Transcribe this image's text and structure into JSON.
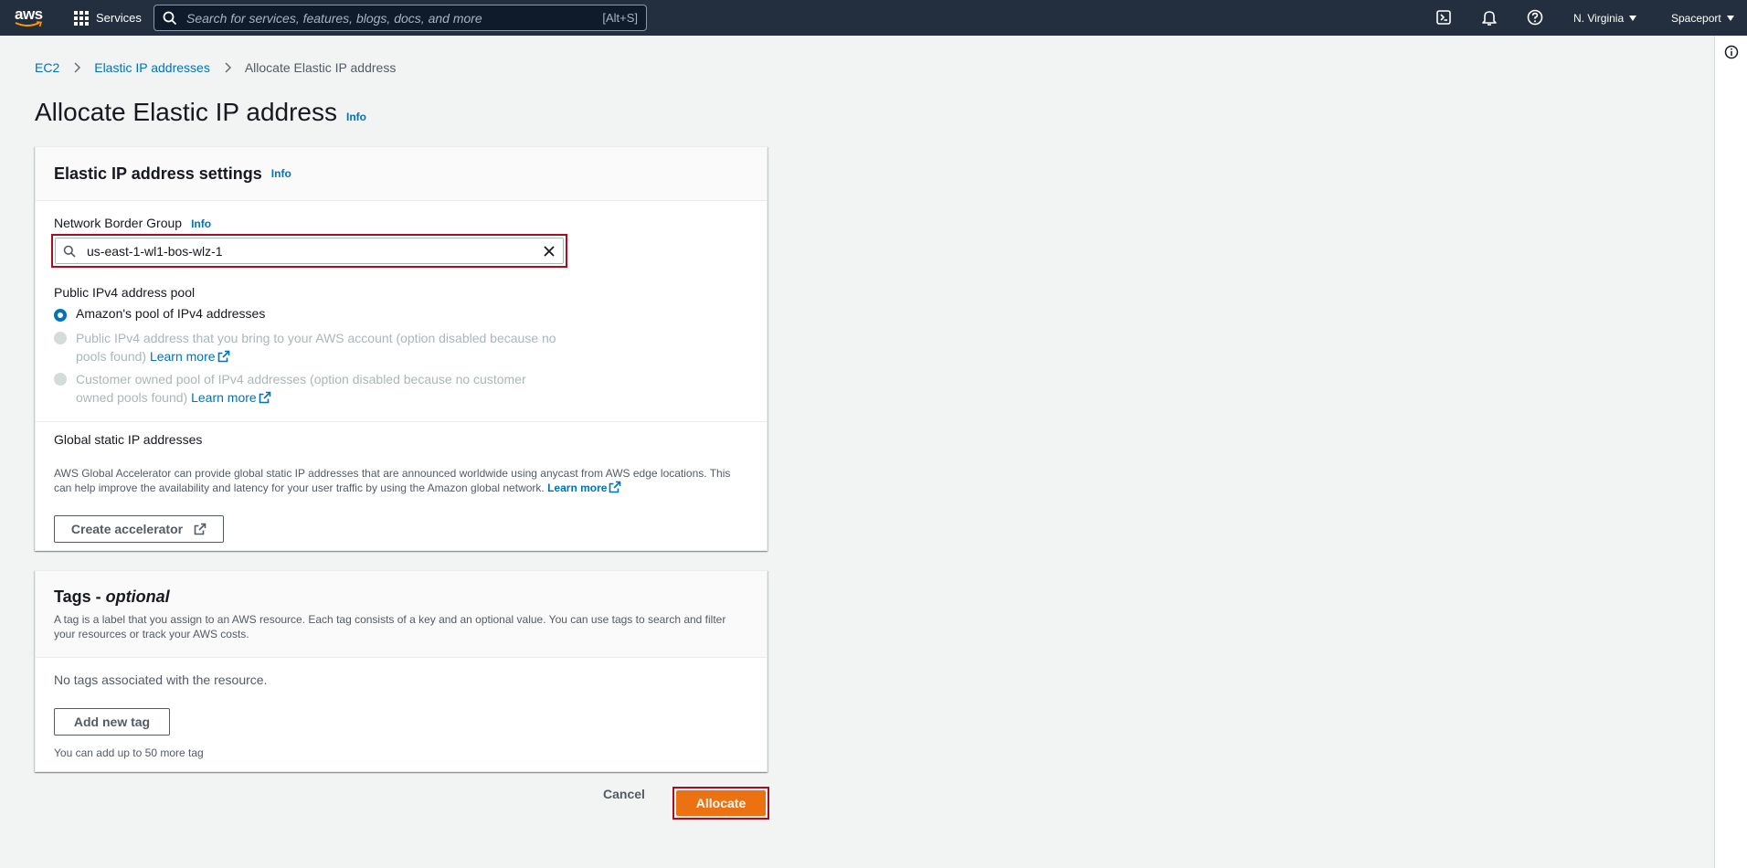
{
  "topnav": {
    "logo_text": "aws",
    "services_label": "Services",
    "search_placeholder": "Search for services, features, blogs, docs, and more",
    "search_shortcut": "[Alt+S]",
    "region": "N. Virginia",
    "account": "Spaceport"
  },
  "breadcrumb": {
    "items": [
      "EC2",
      "Elastic IP addresses"
    ],
    "current": "Allocate Elastic IP address"
  },
  "page": {
    "title": "Allocate Elastic IP address",
    "info": "Info"
  },
  "settings": {
    "header": "Elastic IP address settings",
    "header_info": "Info",
    "nbg_label": "Network Border Group",
    "nbg_info": "Info",
    "nbg_value": "us-east-1-wl1-bos-wlz-1",
    "pool_label": "Public IPv4 address pool",
    "options": [
      {
        "text": "Amazon's pool of IPv4 addresses",
        "selected": true,
        "disabled": false
      },
      {
        "text": "Public IPv4 address that you bring to your AWS account (option disabled because no pools found)",
        "link": "Learn more",
        "selected": false,
        "disabled": true
      },
      {
        "text": "Customer owned pool of IPv4 addresses (option disabled because no customer owned pools found)",
        "link": "Learn more",
        "selected": false,
        "disabled": true
      }
    ],
    "global_label": "Global static IP addresses",
    "global_desc": "AWS Global Accelerator can provide global static IP addresses that are announced worldwide using anycast from AWS edge locations. This can help improve the availability and latency for your user traffic by using the Amazon global network.",
    "global_learn": "Learn more",
    "create_accelerator": "Create accelerator"
  },
  "tags": {
    "header": "Tags - ",
    "header_optional": "optional",
    "desc": "A tag is a label that you assign to an AWS resource. Each tag consists of a key and an optional value. You can use tags to search and filter your resources or track your AWS costs.",
    "empty": "No tags associated with the resource.",
    "add_button": "Add new tag",
    "limit": "You can add up to 50 more tag"
  },
  "actions": {
    "cancel": "Cancel",
    "allocate": "Allocate"
  },
  "colors": {
    "nav_bg": "#232f3e",
    "link": "#0073bb",
    "primary": "#ec7211",
    "highlight": "#aa0d1f"
  }
}
